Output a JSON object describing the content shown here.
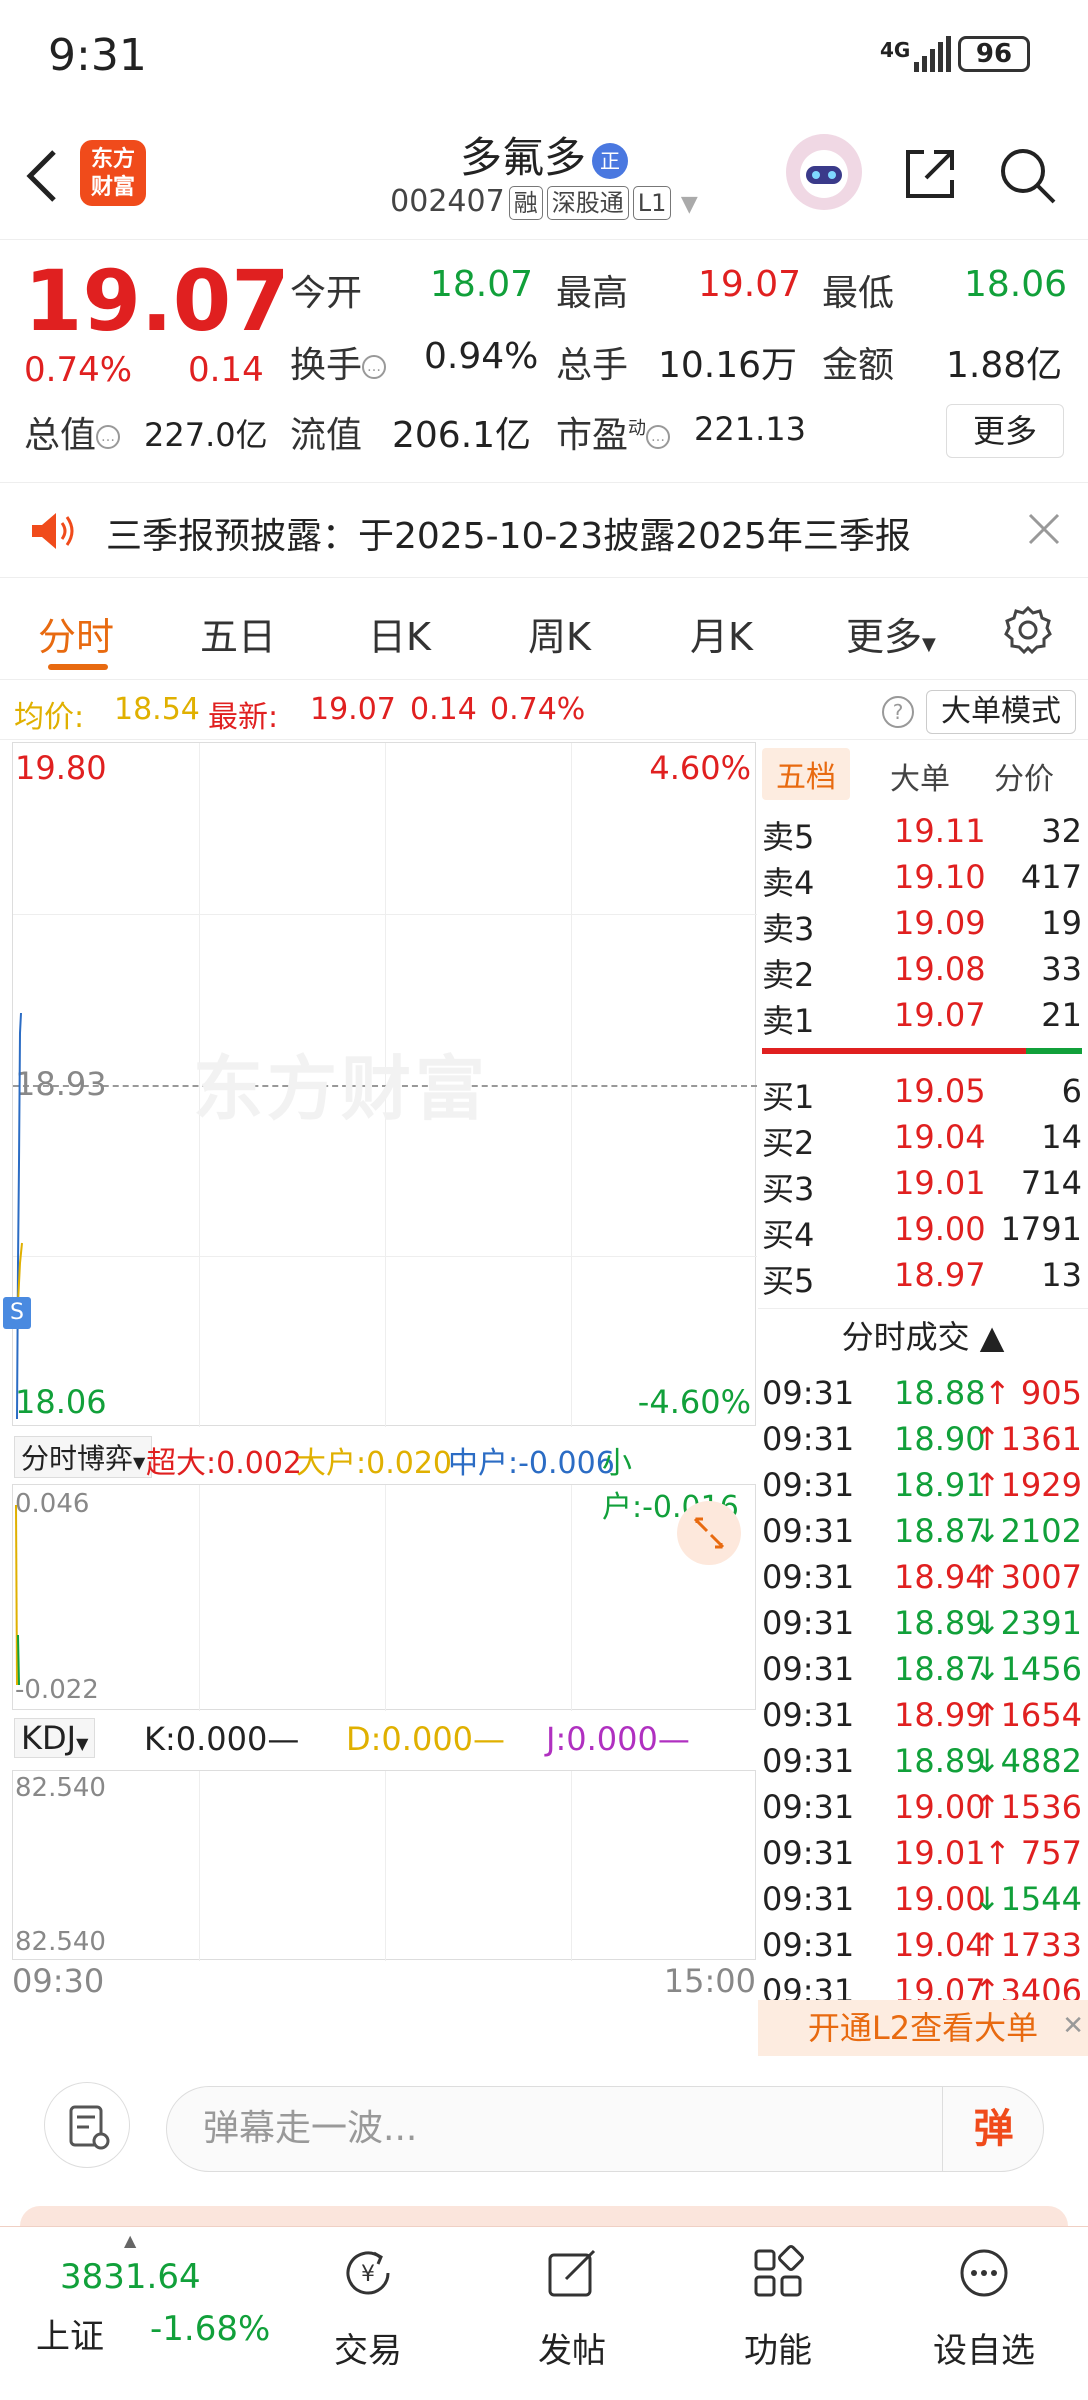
{
  "status": {
    "time": "9:31",
    "network": "4G",
    "battery": "96"
  },
  "header": {
    "logo_line1": "东方",
    "logo_line2": "财富",
    "stock_name": "多氟多",
    "name_badge": "正",
    "code": "002407",
    "tags": [
      "融",
      "深股通",
      "L1"
    ]
  },
  "quote": {
    "price": "19.07",
    "change_pct": "0.74%",
    "change_abs": "0.14",
    "fields": [
      {
        "label": "今开",
        "value": "18.07",
        "color": "green"
      },
      {
        "label": "最高",
        "value": "19.07",
        "color": "red"
      },
      {
        "label": "最低",
        "value": "18.06",
        "color": "green"
      },
      {
        "label": "换手",
        "value": "0.94%",
        "color": "black"
      },
      {
        "label": "总手",
        "value": "10.16万",
        "color": "black"
      },
      {
        "label": "金额",
        "value": "1.88亿",
        "color": "black"
      },
      {
        "label": "总值",
        "value": "227.0亿",
        "color": "black"
      },
      {
        "label": "流值",
        "value": "206.1亿",
        "color": "black"
      },
      {
        "label": "市盈",
        "value": "221.13",
        "color": "black"
      }
    ],
    "pe_superscript": "动",
    "more_label": "更多"
  },
  "notice": {
    "text": "三季报预披露：于2025-10-23披露2025年三季报"
  },
  "tabs": [
    "分时",
    "五日",
    "日K",
    "周K",
    "月K",
    "更多"
  ],
  "avg_line": {
    "avg_label": "均价:",
    "avg_value": "18.54",
    "latest_label": "最新:",
    "latest_price": "19.07",
    "latest_chg": "0.14",
    "latest_pct": "0.74%",
    "help_glyph": "?",
    "mode_button": "大单模式"
  },
  "chart": {
    "y_top": "19.80",
    "y_mid": "18.93",
    "y_bottom": "18.06",
    "pct_top": "4.60%",
    "pct_bottom": "-4.60%",
    "watermark": "东方财富",
    "s_marker": "S",
    "flow": {
      "selector": "分时博弈",
      "items": [
        {
          "label": "超大:",
          "value": "0.002",
          "color": "red"
        },
        {
          "label": "大户:",
          "value": "0.020",
          "color": "yellow"
        },
        {
          "label": "中户:",
          "value": "-0.006",
          "color": "blue"
        },
        {
          "label": "小户:",
          "value": "-0.016",
          "color": "green"
        }
      ],
      "y_top": "0.046",
      "y_bottom": "-0.022"
    },
    "kdj": {
      "selector": "KDJ",
      "k": "K:0.000—",
      "d": "D:0.000—",
      "j": "J:0.000—",
      "y_top": "82.540",
      "y_bottom": "82.540"
    },
    "time_start": "09:30",
    "time_end": "15:00"
  },
  "panel": {
    "tabs": [
      "五档",
      "大单",
      "分价"
    ],
    "asks": [
      {
        "label": "卖5",
        "price": "19.11",
        "vol": "32"
      },
      {
        "label": "卖4",
        "price": "19.10",
        "vol": "417"
      },
      {
        "label": "卖3",
        "price": "19.09",
        "vol": "19"
      },
      {
        "label": "卖2",
        "price": "19.08",
        "vol": "33"
      },
      {
        "label": "卖1",
        "price": "19.07",
        "vol": "21"
      }
    ],
    "bids": [
      {
        "label": "买1",
        "price": "19.05",
        "vol": "6"
      },
      {
        "label": "买2",
        "price": "19.04",
        "vol": "14"
      },
      {
        "label": "买3",
        "price": "19.01",
        "vol": "714"
      },
      {
        "label": "买4",
        "price": "19.00",
        "vol": "1791"
      },
      {
        "label": "买5",
        "price": "18.97",
        "vol": "13"
      }
    ],
    "trades_title": "分时成交 ▲",
    "trades": [
      {
        "time": "09:31",
        "price": "18.88",
        "vol": "↑ 905",
        "color": "green"
      },
      {
        "time": "09:31",
        "price": "18.90",
        "vol": "↑1361",
        "color": "green"
      },
      {
        "time": "09:31",
        "price": "18.91",
        "vol": "↑1929",
        "color": "green"
      },
      {
        "time": "09:31",
        "price": "18.87",
        "vol": "↓2102",
        "color": "green"
      },
      {
        "time": "09:31",
        "price": "18.94",
        "vol": "↑3007",
        "color": "red"
      },
      {
        "time": "09:31",
        "price": "18.89",
        "vol": "↓2391",
        "color": "green"
      },
      {
        "time": "09:31",
        "price": "18.87",
        "vol": "↓1456",
        "color": "green"
      },
      {
        "time": "09:31",
        "price": "18.99",
        "vol": "↑1654",
        "color": "red"
      },
      {
        "time": "09:31",
        "price": "18.89",
        "vol": "↓4882",
        "color": "green"
      },
      {
        "time": "09:31",
        "price": "19.00",
        "vol": "↑1536",
        "color": "red"
      },
      {
        "time": "09:31",
        "price": "19.01",
        "vol": "↑ 757",
        "color": "red"
      },
      {
        "time": "09:31",
        "price": "19.00",
        "vol": "↓1544",
        "color": "red"
      },
      {
        "time": "09:31",
        "price": "19.04",
        "vol": "↑1733",
        "color": "red"
      },
      {
        "time": "09:31",
        "price": "19.07",
        "vol": "↑3406",
        "color": "red"
      }
    ],
    "l2_banner": "开通L2查看大单"
  },
  "comment": {
    "placeholder": "弹幕走一波...",
    "danmu_label": "弹"
  },
  "bottom_nav": {
    "index_value": "3831.64",
    "index_name": "上证",
    "index_change": "-1.68%",
    "items": [
      "交易",
      "发帖",
      "功能",
      "设自选"
    ]
  },
  "colors": {
    "up": "#e02020",
    "down": "#11a03a",
    "accent": "#e86a10",
    "brand": "#f04b1b"
  }
}
